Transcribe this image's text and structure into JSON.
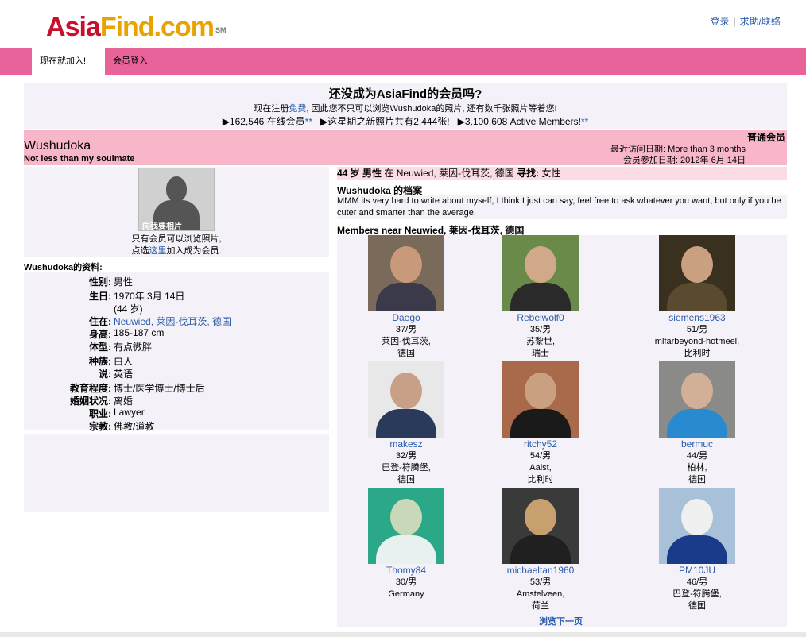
{
  "header": {
    "logo_part1": "Asia",
    "logo_part2": "Find.com",
    "logo_sm": "SM",
    "login": "登录",
    "help": "求助/联络",
    "sep": "|"
  },
  "nav": {
    "join_now": "现在就加入!",
    "member_login": "会员登入"
  },
  "join_banner": {
    "title": "还没成为AsiaFind的会员吗?",
    "line2_pre": "现在注册",
    "line2_free": "免费",
    "line2_post": ", 因此您不只可以浏览Wushudoka的照片, 还有数千张照片等着您!",
    "online": "▶162,546 在线会员",
    "stars": "**",
    "new_photos": "▶这星期之新照片共有2,444张!",
    "active": "▶3,100,608 Active Members!"
  },
  "profile": {
    "username": "Wushudoka",
    "tagline": "Not less than my soulmate",
    "level": "普通会员",
    "last_visit": "最近访问日期: More than 3 months",
    "joined": "会员参加日期: 2012年 6月 14日",
    "photo_ask": "向我要相片",
    "photo_note1": "只有会员可以浏览照片,",
    "photo_note2_pre": "点选",
    "photo_note2_link": "这里",
    "photo_note2_post": "加入成为会员.",
    "info_title": "Wushudoka的资料:",
    "info": [
      {
        "label": "性别:",
        "value": "男性"
      },
      {
        "label": "生日:",
        "value": "1970年 3月 14日"
      },
      {
        "label": "",
        "value": "(44 岁)"
      },
      {
        "label": "住在:",
        "value": "Neuwied, 莱因-伐耳茨, 德国"
      },
      {
        "label": "身高:",
        "value": "185-187 cm"
      },
      {
        "label": "体型:",
        "value": "有点微胖"
      },
      {
        "label": "种族:",
        "value": "白人"
      },
      {
        "label": "说:",
        "value": "英语"
      },
      {
        "label": "教育程度:",
        "value": "博士/医学博士/博士后"
      },
      {
        "label": "婚姻状况:",
        "value": "离婚"
      },
      {
        "label": "职业:",
        "value": "Lawyer"
      },
      {
        "label": "宗教:",
        "value": "佛教/道教"
      }
    ],
    "summary_age": "44 岁 男性",
    "summary_in": "在",
    "summary_location": "Neuwied, 莱因-伐耳茨, 德国",
    "summary_seek": "寻找:",
    "summary_seek_value": "女性",
    "about_title": "Wushudoka 的档案",
    "about_text": "MMM its very hard to write about myself, I think I just can say, feel free to ask whatever you want, but only if you be cuter and smarter than the average.",
    "near_title": "Members near Neuwied, 莱因-伐耳茨, 德国"
  },
  "members": [
    {
      "name": "Daego",
      "age": "37/男",
      "line1": "莱因-伐耳茨,",
      "line2": "德国",
      "bg": "#7a6a5a",
      "skin": "#c99a7a",
      "shirt": "#3a3a4a"
    },
    {
      "name": "Rebelwolf0",
      "age": "35/男",
      "line1": "苏黎世,",
      "line2": "瑞士",
      "bg": "#6a8a4a",
      "skin": "#d2a88a",
      "shirt": "#2a2a2a"
    },
    {
      "name": "siemens1963",
      "age": "51/男",
      "line1": "mlfarbeyond-hotmeel,",
      "line2": "比利时",
      "bg": "#3a3020",
      "skin": "#c9a080",
      "shirt": "#5a4a30"
    },
    {
      "name": "makesz",
      "age": "32/男",
      "line1": "巴登-符腾堡,",
      "line2": "德国",
      "bg": "#e8e8e8",
      "skin": "#c8a088",
      "shirt": "#2a3a5a"
    },
    {
      "name": "ritchy52",
      "age": "54/男",
      "line1": "Aalst,",
      "line2": "比利时",
      "bg": "#a86a4a",
      "skin": "#c9a080",
      "shirt": "#1a1a1a"
    },
    {
      "name": "bermuc",
      "age": "44/男",
      "line1": "柏林,",
      "line2": "德国",
      "bg": "#8a8a88",
      "skin": "#d2b098",
      "shirt": "#2a8ad0"
    },
    {
      "name": "Thomy84",
      "age": "30/男",
      "line1": "Germany",
      "line2": "",
      "bg": "#2aa888",
      "skin": "#c8d8b8",
      "shirt": "#e8f0f0"
    },
    {
      "name": "michaeltan1960",
      "age": "53/男",
      "line1": "Amstelveen,",
      "line2": "荷兰",
      "bg": "#3a3a3a",
      "skin": "#c8a070",
      "shirt": "#202020"
    },
    {
      "name": "PM10JU",
      "age": "46/男",
      "line1": "巴登-符腾堡,",
      "line2": "德国",
      "bg": "#a8c0d8",
      "skin": "#f0f0f0",
      "shirt": "#1a3a8a"
    }
  ],
  "next_page": "浏览下一页"
}
